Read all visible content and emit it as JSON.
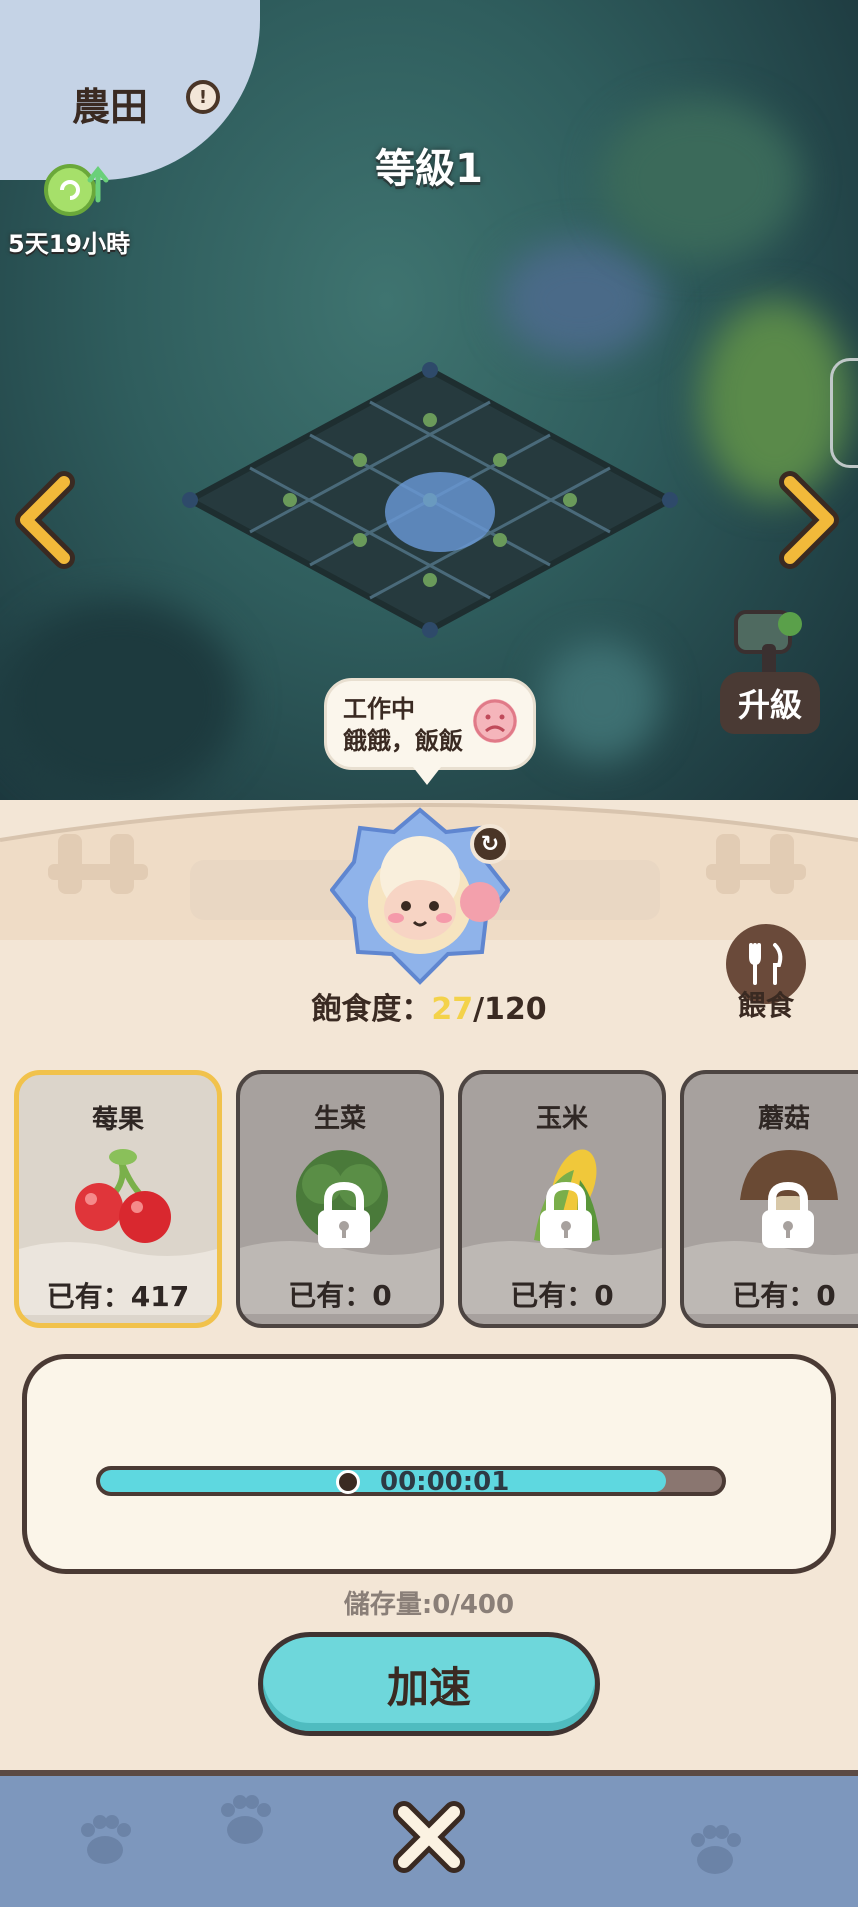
{
  "header": {
    "farm_title": "農田",
    "info_glyph": "!",
    "boost_time": "5天19小時",
    "level": "等級1"
  },
  "upgrade": {
    "label": "升級"
  },
  "status_bubble": {
    "line1": "工作中",
    "line2": "餓餓，飯飯"
  },
  "pet": {
    "satiety_label": "飽食度：",
    "satiety_current": "27",
    "satiety_max": "/120"
  },
  "feed": {
    "label": "餵食"
  },
  "foods": [
    {
      "name": "莓果",
      "owned": "已有：417",
      "locked": false,
      "selected": true
    },
    {
      "name": "生菜",
      "owned": "已有：0",
      "locked": true,
      "selected": false
    },
    {
      "name": "玉米",
      "owned": "已有：0",
      "locked": true,
      "selected": false
    },
    {
      "name": "蘑菇",
      "owned": "已有：0",
      "locked": true,
      "selected": false
    }
  ],
  "production": {
    "timer": "00:00:01",
    "progress": 0.91
  },
  "storage": "儲存量:0/400",
  "speed_up_button": "加速",
  "colors": {
    "accent": "#6ed7db",
    "progress": "#5ed8e0",
    "selected_border": "#f1c24c",
    "footer": "#7d97bd"
  }
}
